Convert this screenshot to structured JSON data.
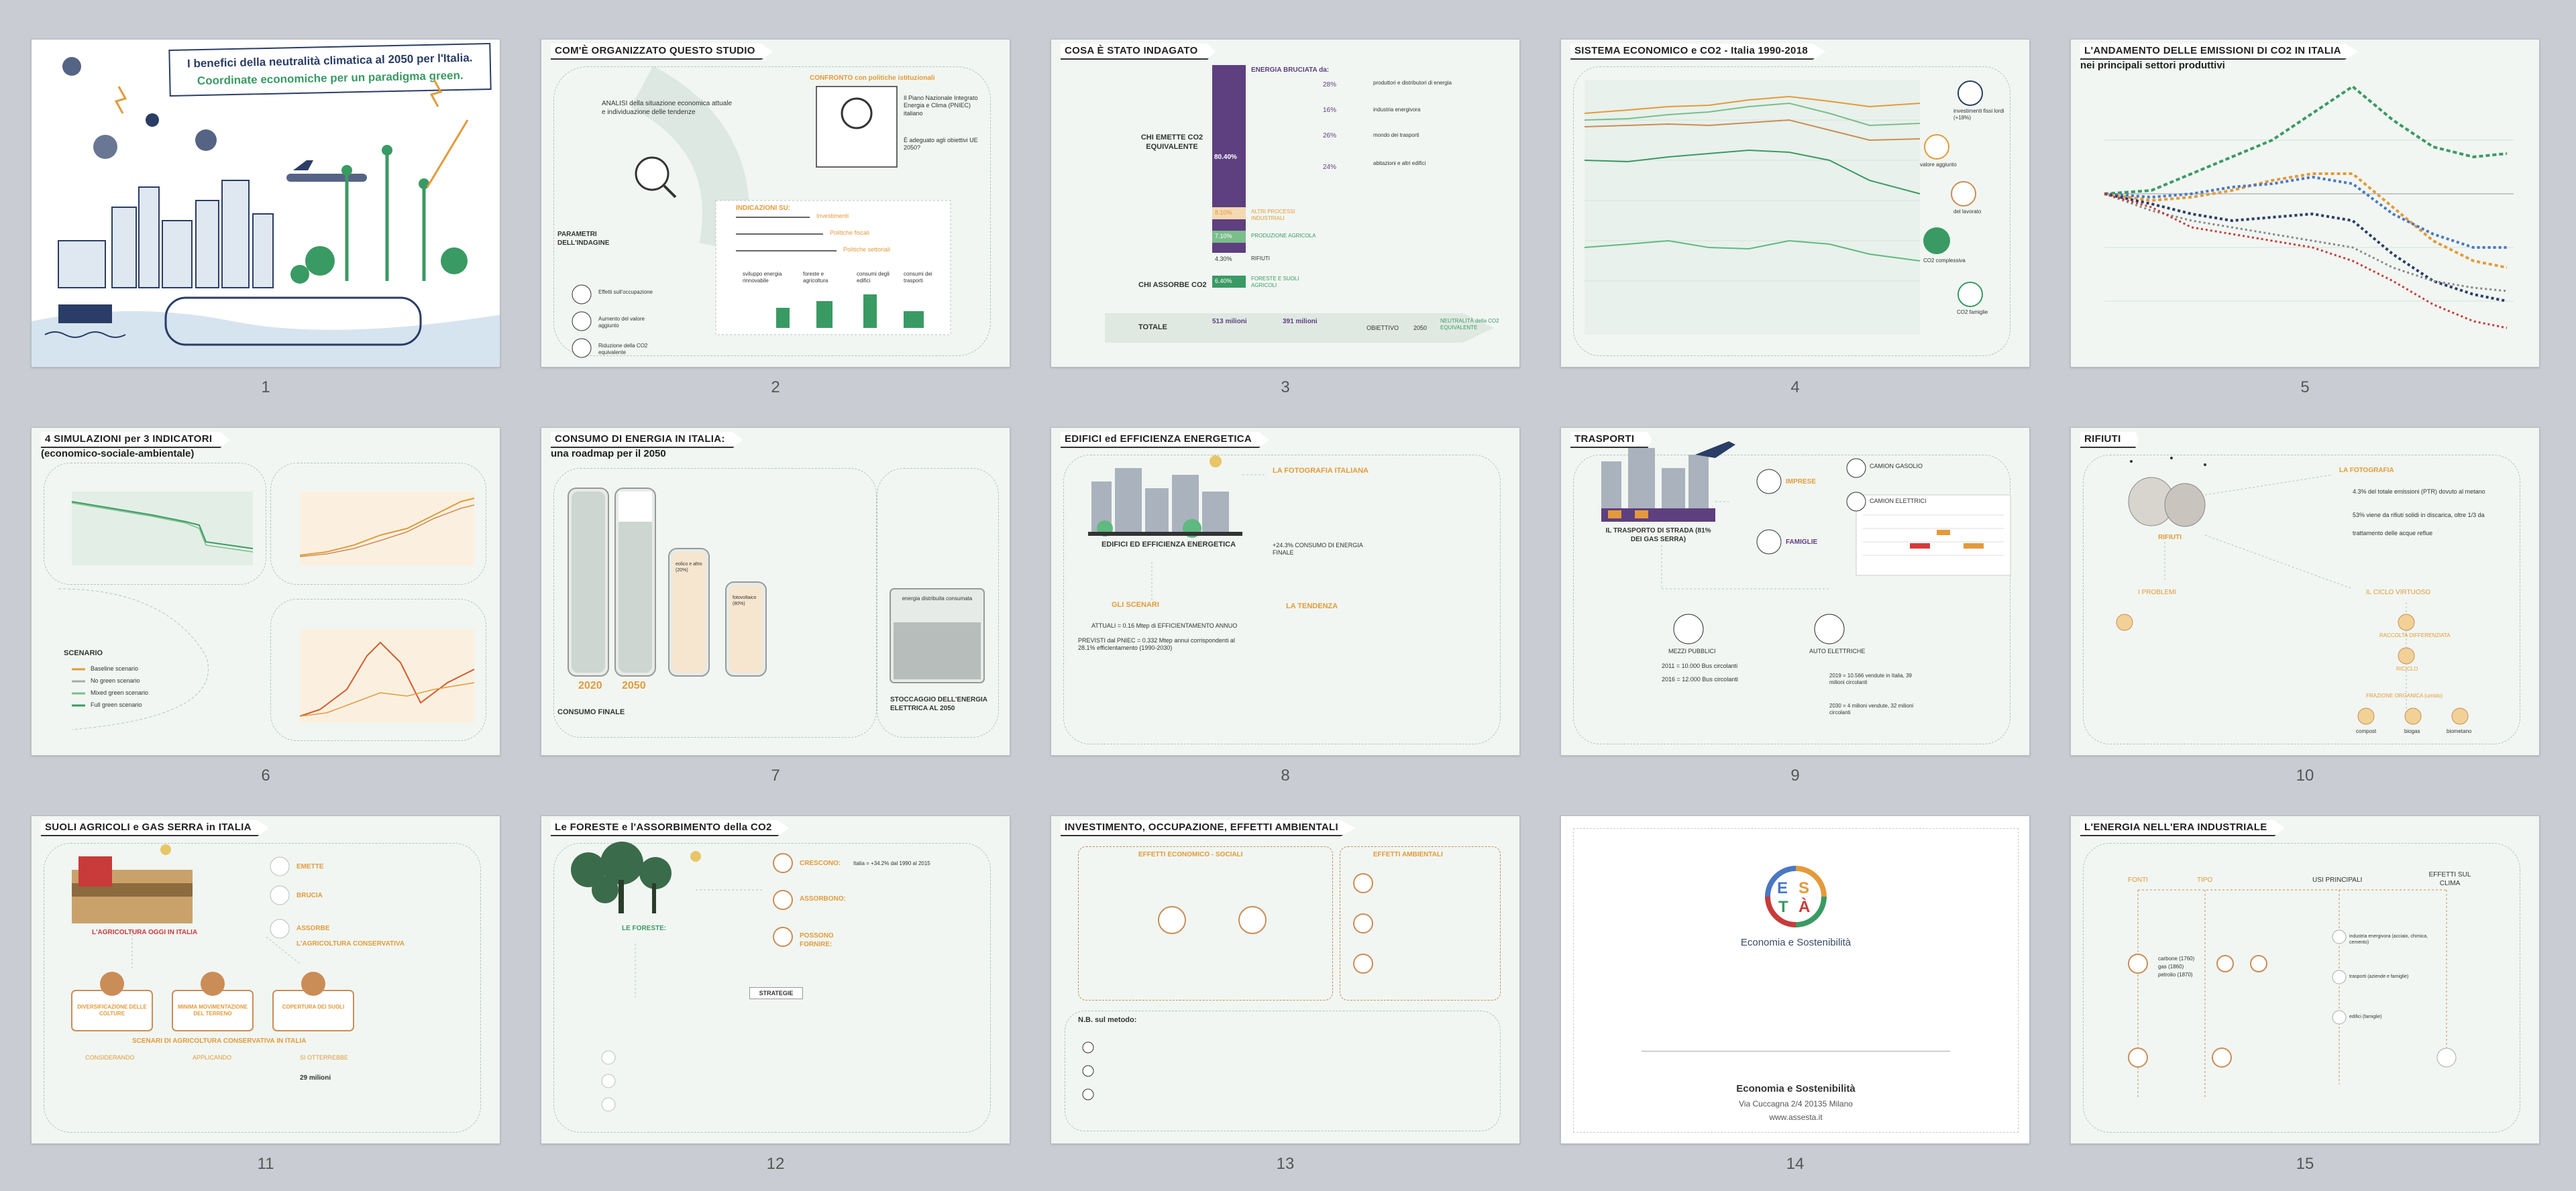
{
  "slides": [
    {
      "num": "1",
      "title_line1": "I benefici della neutralità climatica al 2050 per l'Italia.",
      "title_line2": "Coordinate economiche per un paradigma green."
    },
    {
      "num": "2",
      "title": "COM'È ORGANIZZATO QUESTO STUDIO",
      "analisi": "ANALISI della situazione economica attuale e individuazione delle tendenze",
      "confronto": "CONFRONTO con politiche istituzionali",
      "pniec": "Il Piano Nazionale Integrato Energia e Clima (PNIEC) italiano",
      "adeguato": "È adeguato agli obiettivi UE 2050?",
      "indicazioni": "INDICAZIONI SU:",
      "ind_items": [
        "Investimenti",
        "Politiche fiscali",
        "Politiche settoriali"
      ],
      "bottom_items": [
        "sviluppo energia rinnovabile",
        "foreste e agricoltura",
        "consumi degli edifici",
        "consumi dei trasporti"
      ],
      "parametri": "PARAMETRI DELL'INDAGINE",
      "param_items": [
        "Effetti sull'occupazione",
        "Aumento del valore aggiunto",
        "Riduzione della CO2 equivalente"
      ]
    },
    {
      "num": "3",
      "title": "COSA È STATO INDAGATO",
      "chi_emette": "CHI EMETTE CO2 EQUIVALENTE",
      "chi_assorbe": "CHI ASSORBE CO2",
      "energia": "ENERGIA BRUCIATA da:",
      "pct": [
        "28%",
        "16%",
        "26%",
        "24%"
      ],
      "energia_items": [
        "produttori e distributori di energia",
        "industria energivora",
        "mondo dei trasporti",
        "abitazioni e altri edifici"
      ],
      "big_pct": "80.40%",
      "cats": [
        [
          "8.10%",
          "ALTRI PROCESSI INDUSTRIALI"
        ],
        [
          "7.10%",
          "PRODUZIONE AGRICOLA"
        ],
        [
          "4.30%",
          "RIFIUTI"
        ],
        [
          "6.40%",
          "FORESTE E SUOLI AGRICOLI"
        ]
      ],
      "totale": "TOTALE",
      "neutralita": "NEUTRALITÀ della CO2 EQUIVALENTE",
      "val1990": "513 milioni",
      "val2019": "391 milioni",
      "obiettivo": "OBIETTIVO",
      "y2050": "2050"
    },
    {
      "num": "4",
      "title": "SISTEMA ECONOMICO e CO2 - Italia 1990-2018",
      "labels": [
        "investimenti fissi lordi (+18%)",
        "valore aggiunto",
        "del lavorato",
        "CO2 complessiva",
        "CO2 famiglie"
      ]
    },
    {
      "num": "5",
      "title_line1": "L'ANDAMENTO DELLE EMISSIONI DI CO2 IN ITALIA",
      "title_line2": "nei principali settori produttivi"
    },
    {
      "num": "6",
      "title_line1": "4 SIMULAZIONI per 3 INDICATORI",
      "title_line2": "(economico-sociale-ambientale)",
      "scenario": "SCENARIO",
      "scenarios": [
        "Baseline scenario",
        "No green scenario",
        "Mixed green scenario",
        "Full green scenario"
      ]
    },
    {
      "num": "7",
      "title_line1": "CONSUMO DI ENERGIA IN ITALIA:",
      "title_line2": "una roadmap per il 2050",
      "y2020": "2020",
      "y2050": "2050",
      "consumo_finale": "CONSUMO FINALE",
      "stoccaggio": "STOCCAGGIO DELL'ENERGIA ELETTRICA AL 2050",
      "batt_labels": [
        "eolico e altro (20%)",
        "fotovoltaico (80%)",
        "energia distribuita consumata"
      ]
    },
    {
      "num": "8",
      "title": "EDIFICI ed EFFICIENZA ENERGETICA",
      "foto": "LA FOTOGRAFIA ITALIANA",
      "edifici": "EDIFICI ED EFFICIENZA ENERGETICA",
      "scenari": "GLI SCENARI",
      "tendenza": "LA TENDENZA",
      "consumo": "+24.3% CONSUMO DI ENERGIA FINALE",
      "attuali": "ATTUALI = 0.16 Mtep di EFFICIENTAMENTO ANNUO",
      "previsti": "PREVISTI dal PNIEC = 0.332 Mtep annui corrispondenti al 28.1% efficientamento (1990-2030)"
    },
    {
      "num": "9",
      "title": "TRASPORTI",
      "imprese": "IMPRESE",
      "famiglie": "FAMIGLIE",
      "strada": "IL TRASPORTO DI STRADA (81% DEI GAS SERRA)",
      "mezzi": "MEZZI PUBBLICI",
      "auto": "AUTO ELETTRICHE",
      "camion_gasolio": "CAMION GASOLIO",
      "camion_elettrici": "CAMION ELETTRICI",
      "bus": [
        "2011 = 10.000 Bus circolanti",
        "2016 = 12.000 Bus circolanti"
      ],
      "auto_stats": [
        "2019 = 10.566 vendute in Italia, 39 milioni circolanti",
        "2030 = 4 milioni vendute, 32 milioni circolanti"
      ]
    },
    {
      "num": "10",
      "title": "RIFIUTI",
      "rifiuti": "RIFIUTI",
      "foto": "LA FOTOGRAFIA",
      "problemi": "I PROBLEMI",
      "ciclo": "IL CICLO VIRTUOSO",
      "items": [
        "4.3% del totale emissioni (PTR) dovuto al metano",
        "53% viene da rifiuti solidi in discarica, oltre 1/3 da",
        "trattamento delle acque reflue"
      ],
      "virtuoso": [
        "RACCOLTA DIFFERENZIATA",
        "RICICLO",
        "FRAZIONE ORGANICA (umido)"
      ],
      "ends": [
        "compost",
        "biogas",
        "biometano"
      ]
    },
    {
      "num": "11",
      "title": "SUOLI AGRICOLI e GAS SERRA in ITALIA",
      "emette": "EMETTE",
      "brucia": "BRUCIA",
      "assorbe": "ASSORBE",
      "agricoltura_oggi": "L'AGRICOLTURA OGGI IN ITALIA",
      "agricoltura_cons": "L'AGRICOLTURA CONSERVATIVA",
      "pillars": [
        "DIVERSIFICAZIONE DELLE COLTURE",
        "MINIMA MOVIMENTAZIONE DEL TERRENO",
        "COPERTURA DEI SUOLI"
      ],
      "scenari": "SCENARI DI AGRICOLTURA CONSERVATIVA IN ITALIA",
      "steps": [
        "CONSIDERANDO",
        "APPLICANDO",
        "SI OTTERREBBE"
      ],
      "milioni": "29 milioni"
    },
    {
      "num": "12",
      "title": "Le FORESTE e l'ASSORBIMENTO della CO2",
      "foreste": "LE FORESTE:",
      "verbs": [
        "CRESCONO:",
        "ASSORBONO:",
        "POSSONO FORNIRE:"
      ],
      "strategie": "STRATEGIE",
      "crescono": "Italia = +34.2% dal 1990 al 2015"
    },
    {
      "num": "13",
      "title": "INVESTIMENTO, OCCUPAZIONE, EFFETTI AMBIENTALI",
      "eco": "EFFETTI ECONOMICO - SOCIALI",
      "amb": "EFFETTI AMBIENTALI",
      "nb": "N.B. sul metodo:"
    },
    {
      "num": "14",
      "brand": "Economia e Sostenibilità",
      "logo_letters": [
        "E",
        "S",
        "T",
        "À"
      ],
      "address": "Via Cuccagna 2/4 20135 Milano",
      "url": "www.assesta.it"
    },
    {
      "num": "15",
      "title": "L'ENERGIA NELL'ERA INDUSTRIALE",
      "headers": [
        "FONTI",
        "TIPO",
        "USI PRINCIPALI",
        "EFFETTI SUL CLIMA"
      ],
      "fonti": [
        "carbone (1760)",
        "gas (1860)",
        "petrolio (1870)"
      ],
      "usi": [
        "industria energivora (acciaio, chimica, cemento)",
        "trasporti (aziende e famiglie)",
        "edifici (famiglie)"
      ]
    }
  ],
  "colors": {
    "accent_orange": "#e39a3b",
    "accent_green": "#3a9a63",
    "accent_purple": "#5e3f7f",
    "navy": "#2a3d66",
    "slide_bg": "#f1f6f2"
  }
}
